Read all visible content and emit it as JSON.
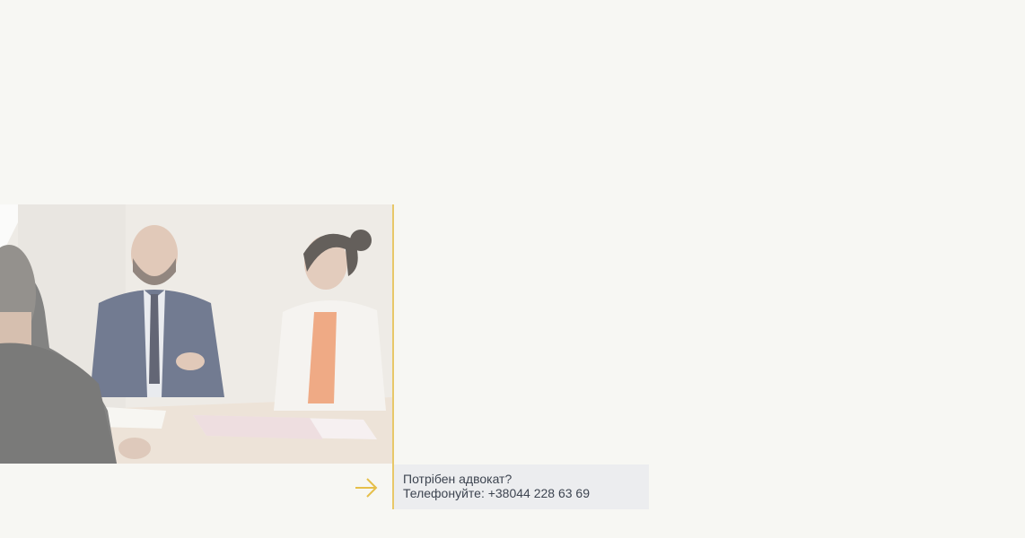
{
  "cta": {
    "title": "Потрібен адвокат?",
    "phone_line": "Телефонуйте: +38044 228 63 69"
  },
  "colors": {
    "background": "#f7f7f3",
    "accent": "#e8c869",
    "cta_background": "#ecedef",
    "cta_text": "#3d4450"
  },
  "icons": {
    "arrow": "arrow-right-icon"
  }
}
